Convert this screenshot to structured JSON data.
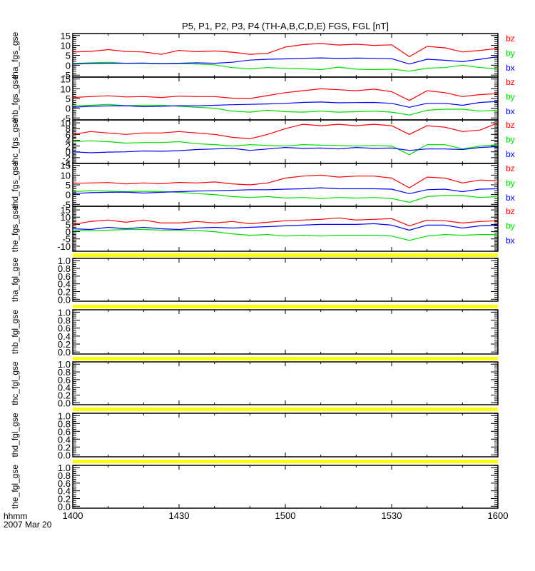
{
  "chart_data": {
    "type": "line",
    "title": "P5, P1, P2, P3, P4 (TH-A,B,C,D,E) FGS, FGL [nT]",
    "x_axis": {
      "label_line1": "hhmm",
      "label_line2": "2007 Mar 20",
      "range_minutes_from_1400": [
        0,
        120
      ],
      "ticks": [
        {
          "t": 0,
          "label": "1400"
        },
        {
          "t": 30,
          "label": "1430"
        },
        {
          "t": 60,
          "label": "1500"
        },
        {
          "t": 90,
          "label": "1530"
        },
        {
          "t": 120,
          "label": "1600"
        }
      ]
    },
    "sample_minutes": [
      0,
      5,
      10,
      15,
      20,
      25,
      30,
      35,
      40,
      45,
      50,
      55,
      60,
      65,
      70,
      75,
      80,
      85,
      90,
      95,
      100,
      105,
      110,
      115,
      120
    ],
    "colors": {
      "bx": "#0000ff",
      "by": "#00dd00",
      "bz": "#ff0000",
      "fill_bar": "#ffff00"
    },
    "legend": [
      "bz",
      "by",
      "bx"
    ],
    "panels": [
      {
        "label": "tha_fgs_gse",
        "ylim": [
          -6,
          16
        ],
        "ticks": [
          -5,
          0,
          5,
          10,
          15
        ],
        "tick_labels": [
          "-5",
          "0",
          "5",
          "10",
          "15"
        ],
        "series": {
          "bz": [
            6.7,
            7.0,
            7.9,
            6.9,
            6.7,
            5.5,
            7.5,
            6.8,
            7.2,
            6.6,
            5.5,
            6.0,
            9.2,
            10.4,
            11.0,
            10.2,
            10.6,
            10.0,
            10.3,
            4.3,
            9.5,
            8.8,
            6.7,
            7.5,
            8.5
          ],
          "by": [
            0.9,
            1.2,
            1.5,
            1.0,
            0.9,
            0.7,
            0.8,
            0.6,
            0.2,
            -1.2,
            -1.8,
            -1.2,
            -1.6,
            -1.8,
            -2.2,
            -1.0,
            -2.0,
            -2.2,
            -2.0,
            -3.0,
            -1.5,
            -1.2,
            0.0,
            -1.2,
            -1.8
          ],
          "bx": [
            0.6,
            0.9,
            1.0,
            1.0,
            1.1,
            0.8,
            1.0,
            1.2,
            1.0,
            1.5,
            2.6,
            3.0,
            3.2,
            3.5,
            3.7,
            3.4,
            3.6,
            3.5,
            3.3,
            0.6,
            3.0,
            2.5,
            1.8,
            3.0,
            4.3
          ]
        }
      },
      {
        "label": "thb_fgs_gse",
        "ylim": [
          -6,
          16
        ],
        "ticks": [
          -5,
          0,
          5,
          10,
          15
        ],
        "tick_labels": [
          "-5",
          "0",
          "5",
          "10",
          "15"
        ],
        "series": {
          "bz": [
            5.5,
            6.0,
            6.4,
            5.8,
            6.0,
            5.5,
            6.2,
            6.0,
            6.0,
            5.2,
            5.0,
            6.5,
            8.0,
            9.0,
            10.0,
            9.5,
            9.0,
            9.8,
            8.5,
            4.0,
            9.0,
            8.0,
            6.0,
            7.0,
            7.5
          ],
          "by": [
            1.2,
            1.5,
            2.0,
            1.3,
            1.6,
            1.5,
            1.0,
            0.5,
            0.0,
            -1.5,
            -2.0,
            -1.0,
            -1.8,
            -2.0,
            -1.5,
            -2.0,
            -1.8,
            -1.5,
            -2.0,
            -3.5,
            -1.0,
            -0.5,
            -0.5,
            -1.5,
            -1.0
          ],
          "bx": [
            0.5,
            1.0,
            1.2,
            1.3,
            0.8,
            1.0,
            1.3,
            1.2,
            1.5,
            1.8,
            2.0,
            2.2,
            2.5,
            3.0,
            3.2,
            2.8,
            2.9,
            3.0,
            2.5,
            0.5,
            2.5,
            2.5,
            1.5,
            3.0,
            3.5
          ]
        }
      },
      {
        "label": "thc_fgs_gse",
        "ylim": [
          -4,
          11
        ],
        "ticks": [
          -4,
          -2,
          0,
          2,
          4,
          6,
          8,
          10
        ],
        "tick_labels": [
          "-4",
          "-2",
          "0",
          "2",
          "4",
          "6",
          "8",
          "10"
        ],
        "series": {
          "bz": [
            6.0,
            7.0,
            6.5,
            6.0,
            6.5,
            6.5,
            7.0,
            6.5,
            6.0,
            5.0,
            4.5,
            6.0,
            8.0,
            9.5,
            9.0,
            9.5,
            9.0,
            9.5,
            9.0,
            6.0,
            9.0,
            8.5,
            7.0,
            7.5,
            10.0
          ],
          "by": [
            3.5,
            3.8,
            3.5,
            3.0,
            3.2,
            3.2,
            3.5,
            2.8,
            2.5,
            2.0,
            2.5,
            2.2,
            2.0,
            2.5,
            2.3,
            2.2,
            2.0,
            2.2,
            2.0,
            -1.0,
            2.5,
            2.5,
            1.0,
            2.0,
            2.5
          ],
          "bx": [
            0.0,
            -0.3,
            -0.1,
            0.0,
            0.3,
            0.2,
            0.4,
            0.8,
            1.0,
            1.2,
            0.5,
            1.0,
            1.5,
            1.2,
            1.3,
            1.0,
            1.5,
            1.2,
            1.3,
            0.5,
            1.0,
            1.0,
            0.8,
            1.5,
            1.8
          ]
        }
      },
      {
        "label": "thd_fgs_gse",
        "ylim": [
          -6,
          16
        ],
        "ticks": [
          -5,
          0,
          5,
          10,
          15
        ],
        "tick_labels": [
          "-5",
          "0",
          "5",
          "10",
          "15"
        ],
        "series": {
          "bz": [
            5.8,
            6.0,
            6.2,
            5.5,
            6.0,
            5.6,
            6.3,
            6.0,
            6.5,
            5.5,
            5.0,
            6.0,
            8.5,
            9.5,
            10.0,
            9.0,
            9.5,
            9.5,
            8.5,
            3.5,
            9.0,
            8.5,
            6.0,
            7.5,
            7.0
          ],
          "by": [
            1.5,
            2.0,
            1.8,
            1.5,
            1.7,
            1.5,
            1.2,
            0.5,
            0.0,
            -1.0,
            -1.5,
            -1.0,
            -1.8,
            -1.5,
            -2.0,
            -1.5,
            -1.8,
            -1.5,
            -2.0,
            -4.0,
            -1.0,
            -0.5,
            -0.5,
            -1.5,
            -1.0
          ],
          "bx": [
            0.5,
            1.0,
            1.2,
            1.3,
            0.8,
            1.2,
            1.5,
            1.8,
            2.0,
            2.2,
            2.5,
            2.5,
            2.8,
            3.0,
            3.5,
            3.0,
            3.0,
            3.0,
            2.8,
            0.5,
            2.5,
            2.8,
            1.5,
            2.8,
            3.0
          ]
        }
      },
      {
        "label": "the_fgs_gse",
        "ylim": [
          -13.5,
          17.5
        ],
        "ticks": [
          -10,
          -5,
          0,
          5,
          10,
          15
        ],
        "tick_labels": [
          "-10",
          "-5",
          "0",
          "5",
          "10",
          "15"
        ],
        "series": {
          "bz": [
            5.0,
            7.0,
            8.0,
            6.5,
            8.0,
            6.0,
            6.0,
            7.0,
            6.0,
            7.0,
            5.5,
            6.5,
            7.5,
            8.0,
            8.5,
            9.5,
            8.0,
            8.5,
            9.0,
            4.0,
            8.0,
            7.5,
            6.0,
            7.0,
            7.5
          ],
          "by": [
            1.0,
            0.5,
            1.0,
            1.5,
            1.5,
            1.0,
            1.0,
            0.8,
            0.0,
            -1.5,
            -2.5,
            -2.0,
            -3.0,
            -2.5,
            -3.0,
            -2.5,
            -2.5,
            -2.5,
            -3.0,
            -6.0,
            -3.0,
            -2.0,
            -2.5,
            -2.0,
            -2.0
          ],
          "bx": [
            2.0,
            1.5,
            3.0,
            2.0,
            3.0,
            2.0,
            1.5,
            2.5,
            3.0,
            2.5,
            3.0,
            3.5,
            4.0,
            4.5,
            5.0,
            5.0,
            5.0,
            5.5,
            4.5,
            1.0,
            4.5,
            4.5,
            2.5,
            4.0,
            4.5
          ]
        }
      },
      {
        "label": "tha_fgl_gse",
        "ylim": [
          -0.05,
          1.06
        ],
        "ticks": [
          0,
          0.2,
          0.4,
          0.6,
          0.8,
          1.0
        ],
        "tick_labels": [
          "0.0",
          "0.2",
          "0.4",
          "0.6",
          "0.8",
          "1.0"
        ],
        "series": {}
      },
      {
        "label": "thb_fgl_gse",
        "ylim": [
          -0.05,
          1.06
        ],
        "ticks": [
          0,
          0.2,
          0.4,
          0.6,
          0.8,
          1.0
        ],
        "tick_labels": [
          "0.0",
          "0.2",
          "0.4",
          "0.6",
          "0.8",
          "1.0"
        ],
        "series": {}
      },
      {
        "label": "thc_fgl_gse",
        "ylim": [
          -0.05,
          1.06
        ],
        "ticks": [
          0,
          0.2,
          0.4,
          0.6,
          0.8,
          1.0
        ],
        "tick_labels": [
          "0.0",
          "0.2",
          "0.4",
          "0.6",
          "0.8",
          "1.0"
        ],
        "series": {}
      },
      {
        "label": "thd_fgl_gse",
        "ylim": [
          -0.05,
          1.06
        ],
        "ticks": [
          0,
          0.2,
          0.4,
          0.6,
          0.8,
          1.0
        ],
        "tick_labels": [
          "0.0",
          "0.2",
          "0.4",
          "0.6",
          "0.8",
          "1.0"
        ],
        "series": {}
      },
      {
        "label": "the_fgl_gse",
        "ylim": [
          -0.05,
          1.06
        ],
        "ticks": [
          0,
          0.2,
          0.4,
          0.6,
          0.8,
          1.0
        ],
        "tick_labels": [
          "0.0",
          "0.2",
          "0.4",
          "0.6",
          "0.8",
          "1.0"
        ],
        "series": {}
      }
    ]
  }
}
